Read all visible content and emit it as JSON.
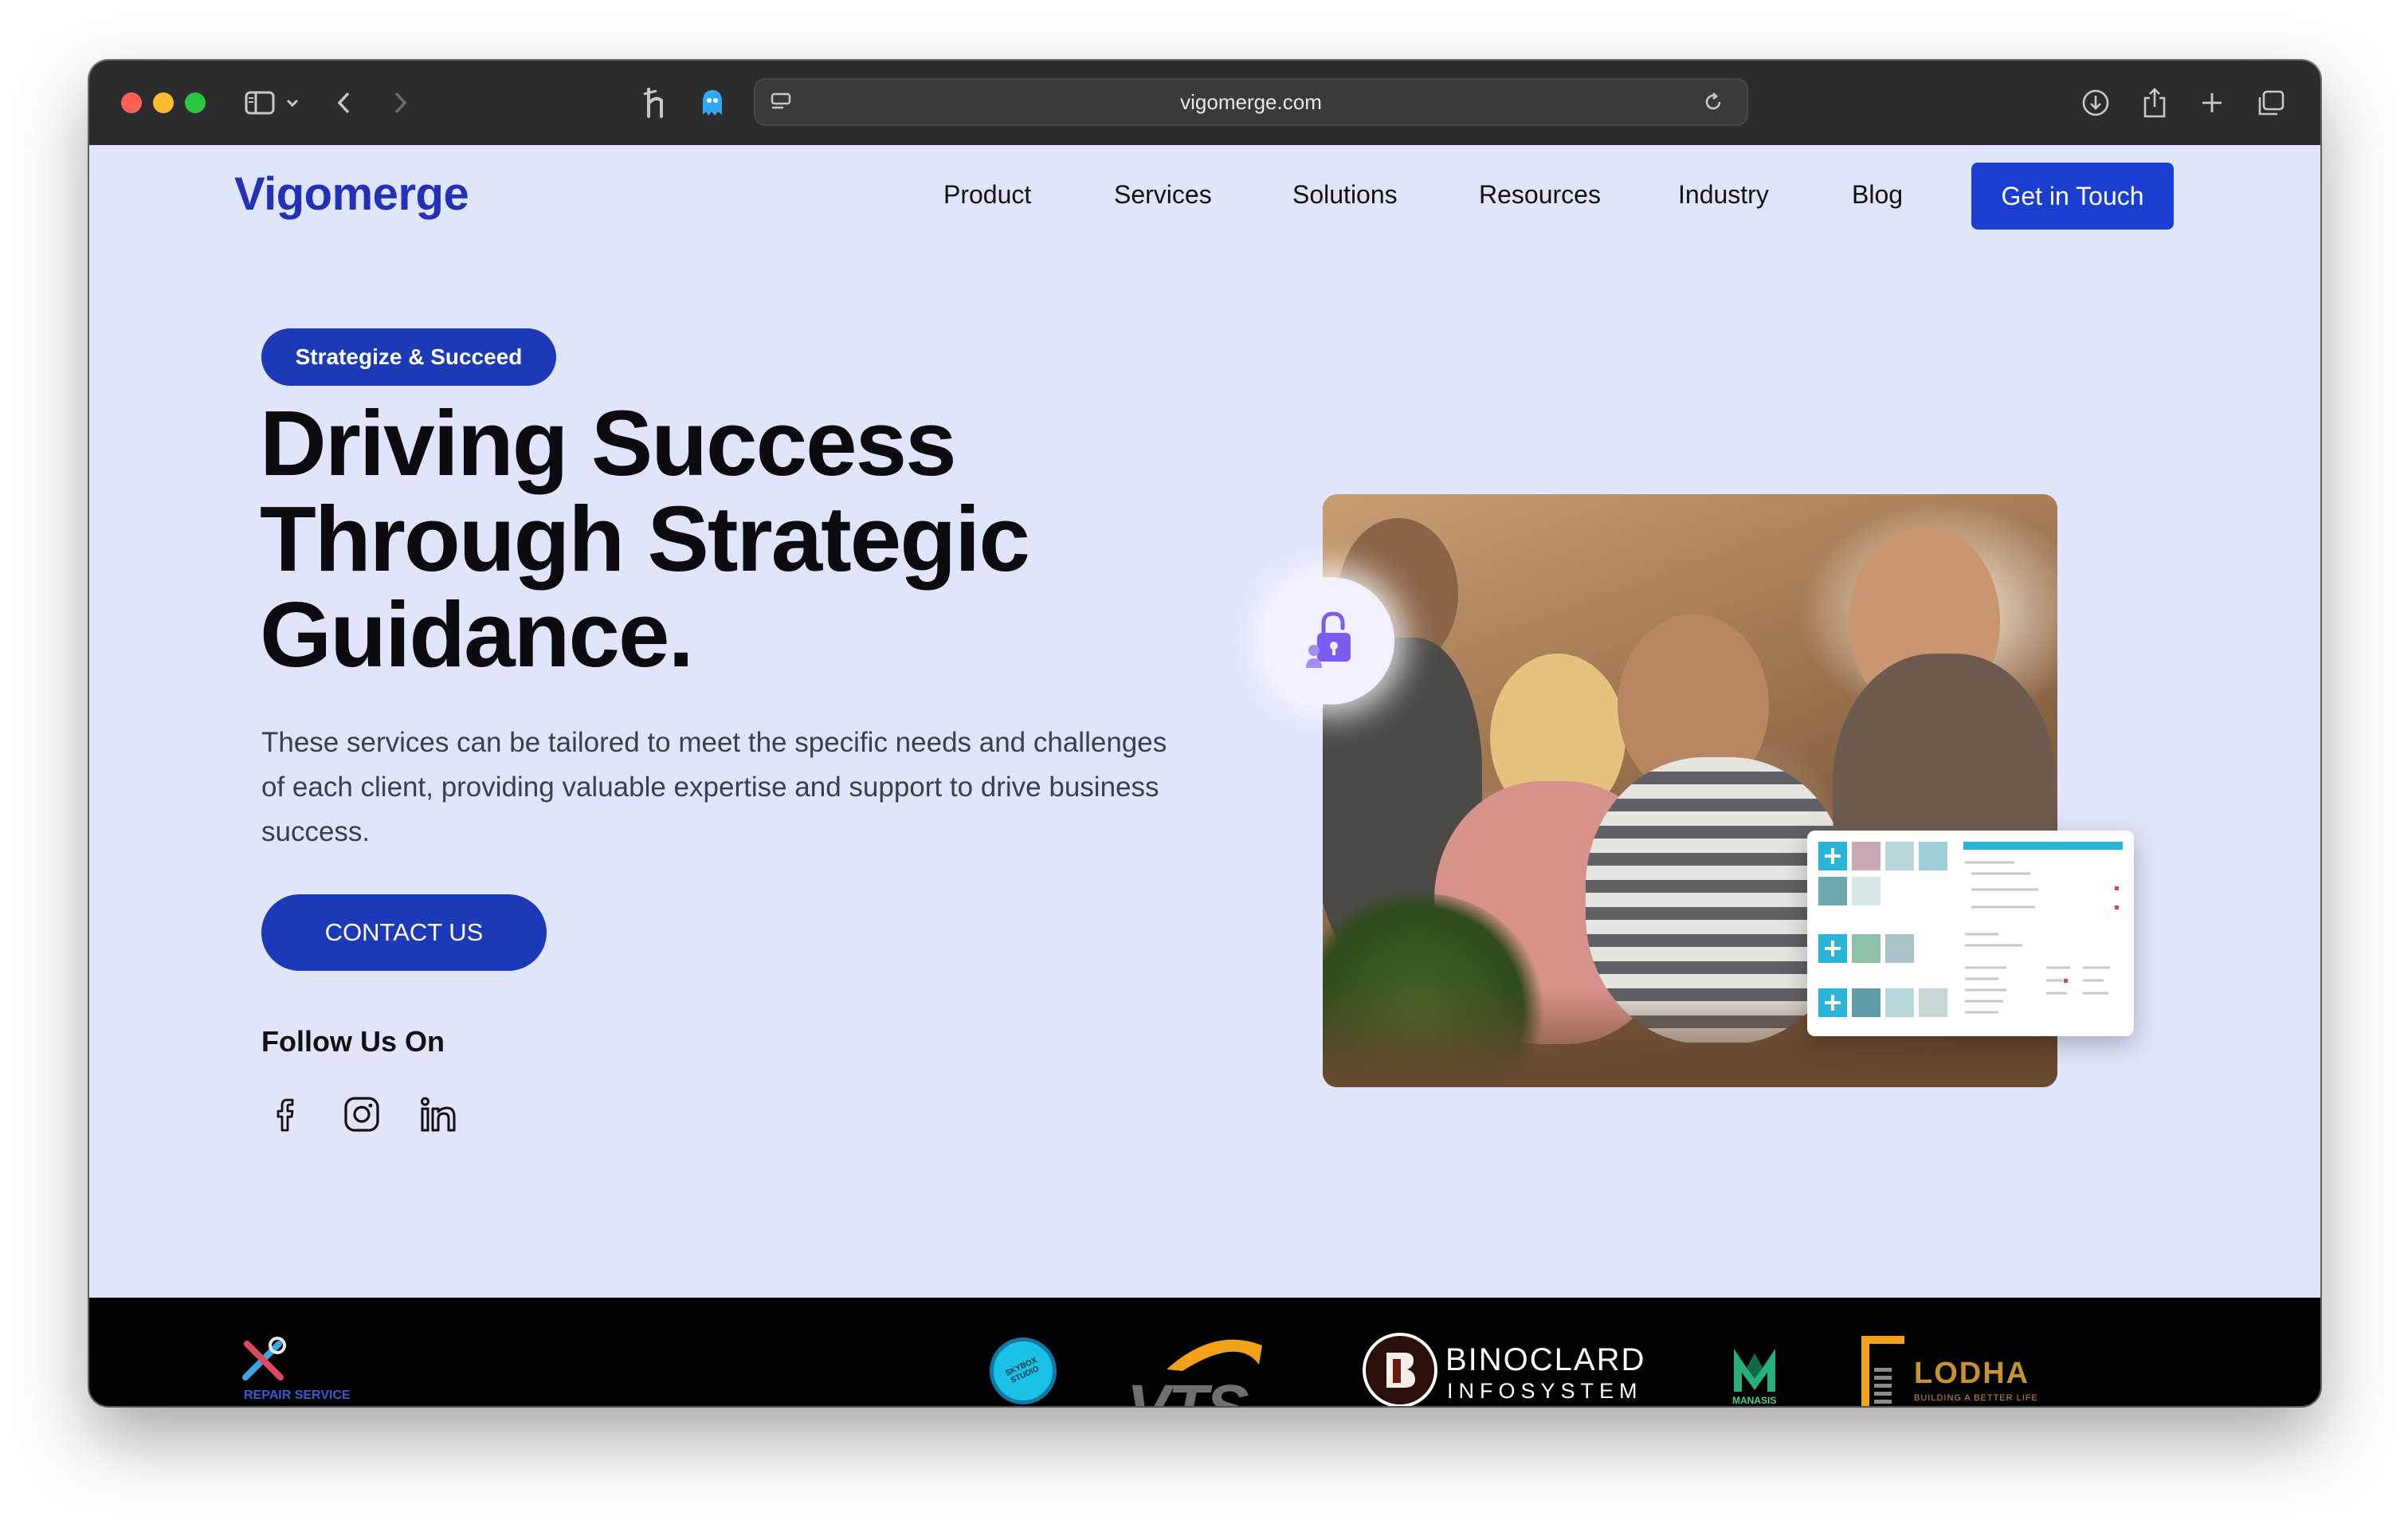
{
  "browser": {
    "url": "vigomerge.com"
  },
  "header": {
    "logo": "Vigomerge",
    "nav": [
      "Product",
      "Services",
      "Solutions",
      "Resources",
      "Industry",
      "Blog"
    ],
    "cta": "Get in Touch"
  },
  "hero": {
    "badge": "Strategize & Succeed",
    "headline": [
      "Driving Success",
      "Through Strategic",
      "Guidance."
    ],
    "description": "These services can be tailored to meet the specific needs and challenges of each client, providing valuable expertise and support to drive business success.",
    "contact_button": "CONTACT US",
    "follow_label": "Follow Us On",
    "social_icons": [
      "facebook-icon",
      "instagram-icon",
      "linkedin-icon"
    ]
  },
  "clients": {
    "repair_logo_text": "REPAIR SERVICE",
    "skybox_text": "SKYBOX STUDIO",
    "vts_text": "VTS",
    "binoclard_line1": "BINOCLARD",
    "binoclard_line2": "INFOSYSTEM",
    "manasis_text": "MANASIS",
    "lodha_text": "LODHA",
    "lodha_tagline": "BUILDING A BETTER LIFE"
  },
  "colors": {
    "brand": "#2231b8",
    "primary_button": "#1c3ab7",
    "hero_bg": "#e0e5fb",
    "strip_bg": "#000000"
  }
}
